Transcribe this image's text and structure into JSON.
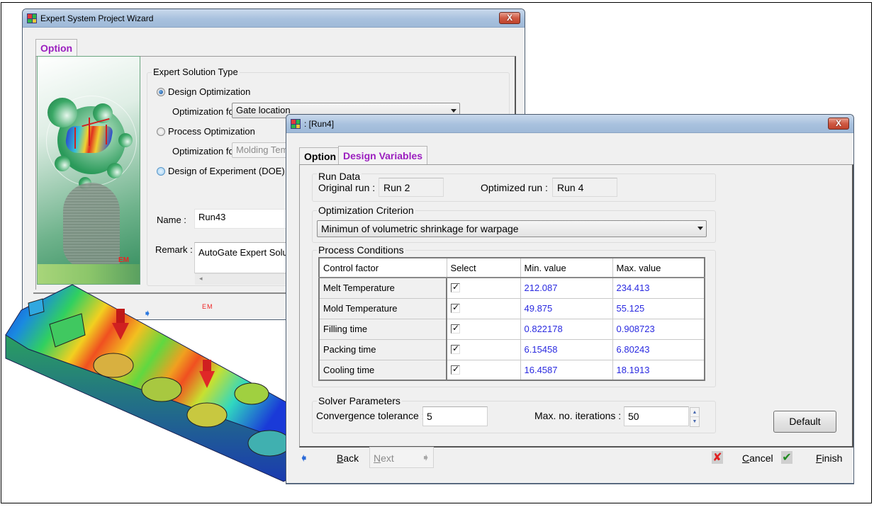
{
  "wizard": {
    "title": "Expert System Project Wizard",
    "close_label": "X",
    "tabs": [
      {
        "label": "Option",
        "active": true
      }
    ],
    "solution_type": {
      "group_label": "Expert Solution Type",
      "options": [
        {
          "label": "Design Optimization",
          "checked": true
        },
        {
          "label": "Process Optimization",
          "checked": false
        },
        {
          "label": "Design of Experiment (DOE) An",
          "checked": false
        }
      ],
      "design_opt_for_label": "Optimization for",
      "design_opt_for_value": "Gate location",
      "process_opt_for_label": "Optimization for",
      "process_opt_for_value": "Molding Temp"
    },
    "name_label": "Name :",
    "name_value": "Run43",
    "remark_label": "Remark :",
    "remark_value": "AutoGate Expert Soluti",
    "illustration_logo": "EM",
    "footer_logo": "EM"
  },
  "run_dialog": {
    "title": ": [Run4]",
    "close_label": "X",
    "tabs": [
      {
        "label": "Option",
        "active": false
      },
      {
        "label": "Design Variables",
        "active": true
      }
    ],
    "run_data": {
      "group_label": "Run Data",
      "original_label": "Original run :",
      "original_value": "Run 2",
      "optimized_label": "Optimized run :",
      "optimized_value": "Run 4"
    },
    "criterion": {
      "group_label": "Optimization Criterion",
      "selected": "Minimun of volumetric shrinkage for warpage"
    },
    "process_conditions": {
      "group_label": "Process Conditions",
      "columns": [
        "Control factor",
        "Select",
        "Min. value",
        "Max. value"
      ],
      "rows": [
        {
          "factor": "Melt Temperature",
          "selected": true,
          "min": "212.087",
          "max": "234.413"
        },
        {
          "factor": "Mold Temperature",
          "selected": true,
          "min": "49.875",
          "max": "55.125"
        },
        {
          "factor": "Filling time",
          "selected": true,
          "min": "0.822178",
          "max": "0.908723"
        },
        {
          "factor": "Packing time",
          "selected": true,
          "min": "6.15458",
          "max": "6.80243"
        },
        {
          "factor": "Cooling time",
          "selected": true,
          "min": "16.4587",
          "max": "18.1913"
        }
      ]
    },
    "solver": {
      "group_label": "Solver Parameters",
      "tolerance_label": "Convergence tolerance :",
      "tolerance_value": "5",
      "iterations_label": "Max. no. iterations :",
      "iterations_value": "50"
    },
    "default_button": "Default",
    "footer": {
      "back": {
        "accel": "B",
        "rest": "ack"
      },
      "next": {
        "accel": "N",
        "rest": "ext",
        "enabled": false
      },
      "cancel": {
        "accel": "C",
        "rest": "ancel"
      },
      "finish": {
        "accel": "F",
        "rest": "inish"
      }
    }
  },
  "colors": {
    "active_tab": "#9b1fbf",
    "numeric_values": "#2a2ae0",
    "cancel_icon": "#e02020",
    "finish_icon": "#1f8a1f",
    "logo_red": "#e22222"
  }
}
